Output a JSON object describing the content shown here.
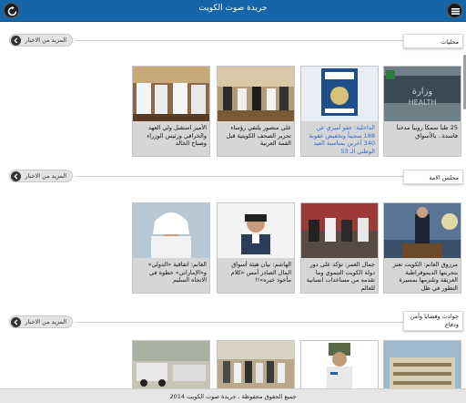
{
  "app": {
    "title": "جريدة صوت الكويت",
    "footer": "جميع الحقوق محفوظة ، جريدة صوت الكويت 2014"
  },
  "icons": {
    "menu": "menu-icon",
    "refresh": "refresh-icon",
    "chevron": "chevron-left-icon"
  },
  "colors": {
    "header": "#1565a8",
    "link_highlight": "#2a6bd1"
  },
  "sections": [
    {
      "label": "محليات",
      "more": "المزيد من الاخبار",
      "cards": [
        {
          "caption": "25 طناً سمكاً روبياً مدخناً فاسدة.. بالأسواق",
          "highlight": false
        },
        {
          "caption": "الداخلية: عفو أميري عن 188 سجيناً وتخفيض عقوبة 340 آخرين بمناسبة العيد الوطني الـ 53",
          "highlight": true
        },
        {
          "caption": "علي منصور يلتقي رؤساء تحرير الصحف الكويتية قبل القمة العربية",
          "highlight": false
        },
        {
          "caption": "الأمير استقبل ولي العهد والخرافي ورئيس الوزراء وصباح الخالد",
          "highlight": false
        }
      ]
    },
    {
      "label": "مجلس الامة",
      "more": "المزيد من الاخبار",
      "cards": [
        {
          "caption": "مرزوق الغانم: الكويت تعتز بتجربتها الديموقراطية العريقة وتلتزمها بمسيرة التطور في ظل",
          "highlight": false
        },
        {
          "caption": "جمال العمر: تؤكد على دور دولة الكويت التنموي وما تقدمه من مساعدات انسانية للعالم",
          "highlight": false
        },
        {
          "caption": "الهاشم: بيان هيئة أسواق المال الصادر أمس «كلام مأخوذ خيره»!!",
          "highlight": false
        },
        {
          "caption": "الغانم: اتفاقية «الدولي» و«الإماراتي» خطوة في الاتجاه السليم",
          "highlight": false
        }
      ]
    },
    {
      "label": "حوادث وقضايا وأمن ودفاع",
      "more": "المزيد من الاخبار",
      "cards": [
        {
          "caption": "",
          "highlight": false
        },
        {
          "caption": "",
          "highlight": false
        },
        {
          "caption": "",
          "highlight": false
        },
        {
          "caption": "",
          "highlight": false
        }
      ]
    }
  ]
}
